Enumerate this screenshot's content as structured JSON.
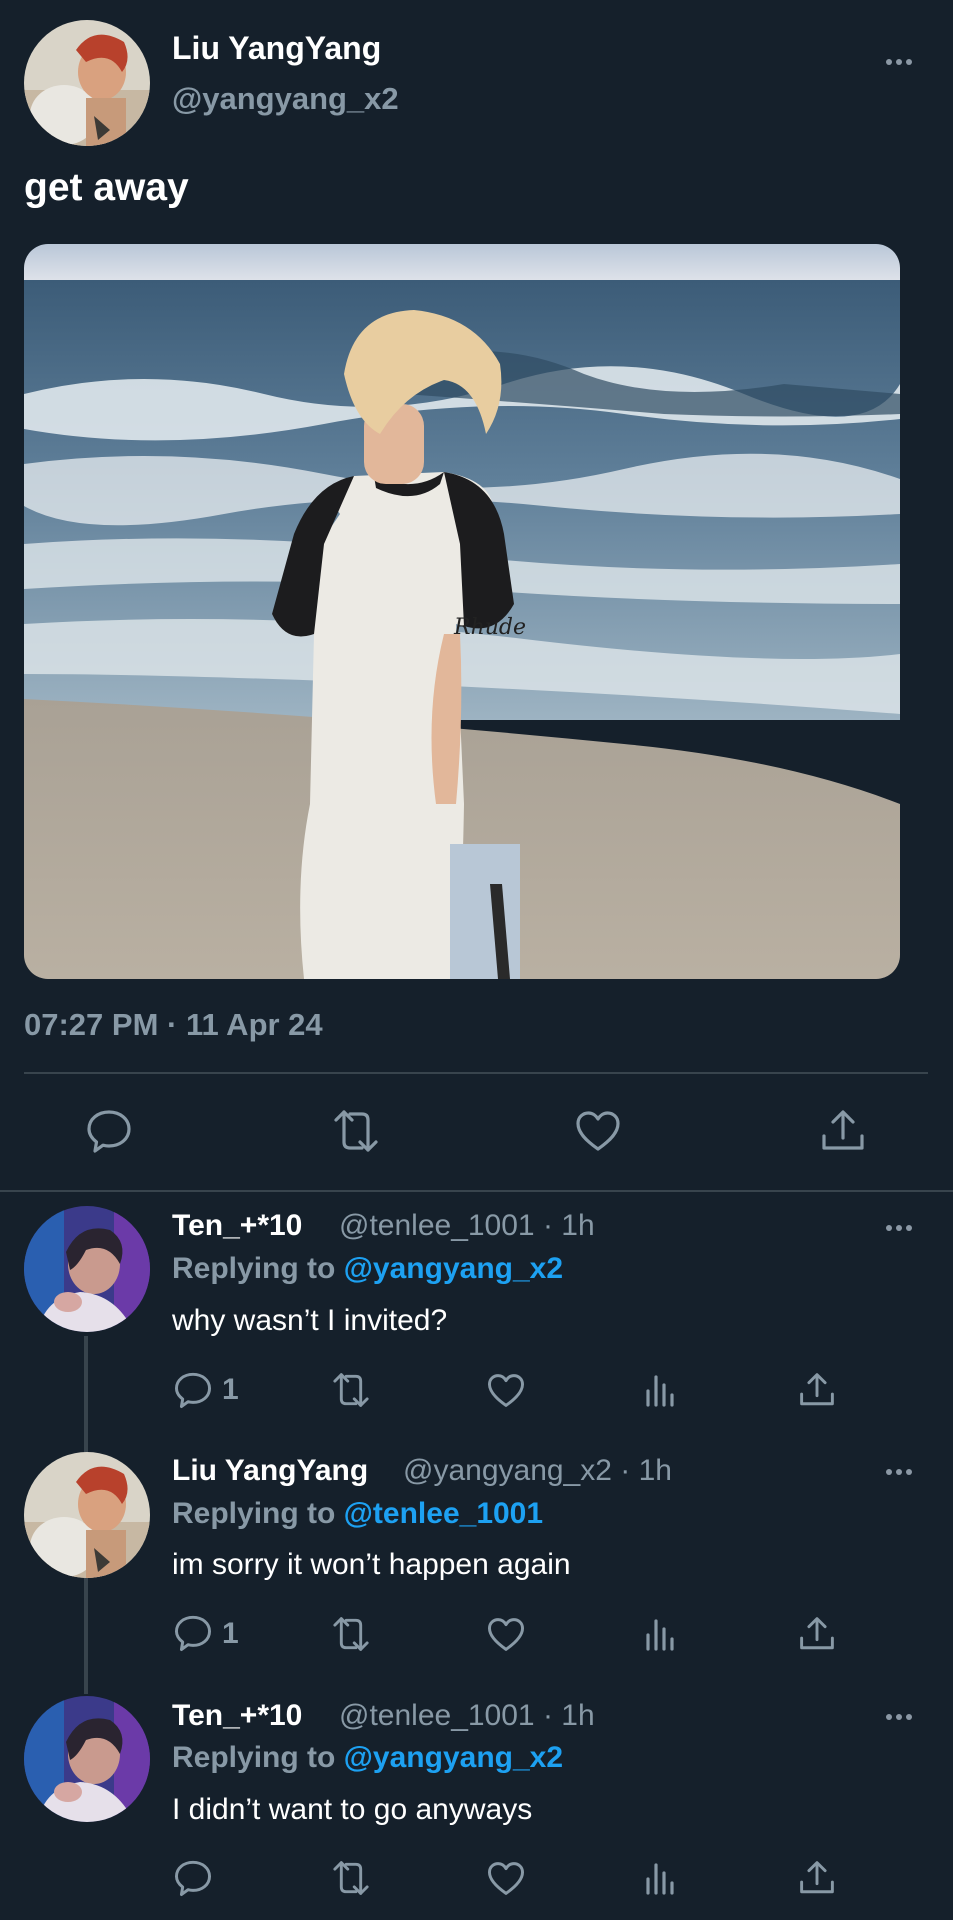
{
  "tweet": {
    "author_name": "Liu YangYang",
    "author_handle": "@yangyang_x2",
    "text": "get away",
    "timestamp": "07:27 PM · 11 Apr 24"
  },
  "replies": [
    {
      "name": "Ten_+*10",
      "meta": "@tenlee_1001 · 1h",
      "replying_prefix": "Replying to ",
      "replying_to": "@yangyang_x2",
      "text": "why wasn’t I invited?",
      "reply_count": "1"
    },
    {
      "name": "Liu YangYang",
      "meta": "@yangyang_x2 · 1h",
      "replying_prefix": "Replying to ",
      "replying_to": "@tenlee_1001",
      "text": "im sorry it won’t happen again",
      "reply_count": "1"
    },
    {
      "name": "Ten_+*10",
      "meta": "@tenlee_1001 · 1h",
      "replying_prefix": "Replying to ",
      "replying_to": "@yangyang_x2",
      "text": "I didn’t want to go anyways",
      "reply_count": ""
    }
  ],
  "icons": {
    "reply": "speech-bubble-icon",
    "retweet": "retweet-arrows-icon",
    "like": "heart-icon",
    "share": "upload-arrow-icon",
    "views": "bar-chart-icon",
    "more": "ellipsis-icon"
  },
  "colors": {
    "background": "#15202b",
    "primary_text": "#ffffff",
    "secondary_text": "#8899a6",
    "accent": "#1da1f2",
    "divider": "#38444d"
  }
}
